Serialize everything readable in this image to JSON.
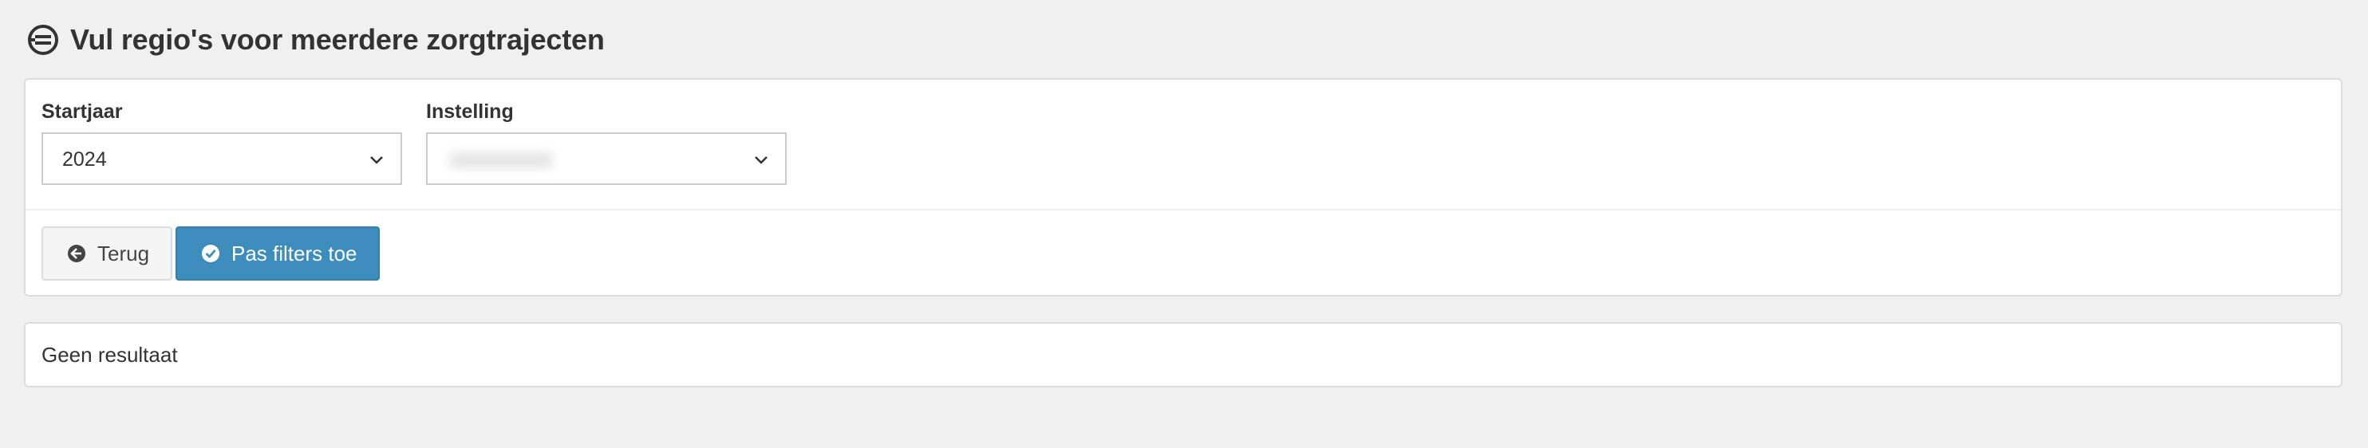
{
  "page": {
    "title": "Vul regio's voor meerdere zorgtrajecten",
    "title_icon": "no-entry-circle-icon"
  },
  "filters": {
    "startjaar": {
      "label": "Startjaar",
      "value": "2024"
    },
    "instelling": {
      "label": "Instelling",
      "value": ""
    }
  },
  "actions": {
    "back_label": "Terug",
    "back_icon": "arrow-circle-left-icon",
    "apply_label": "Pas filters toe",
    "apply_icon": "check-circle-icon"
  },
  "results": {
    "empty_text": "Geen resultaat"
  },
  "colors": {
    "background": "#f0f0f0",
    "primary": "#3c8dbc",
    "default_button": "#f4f4f4"
  }
}
